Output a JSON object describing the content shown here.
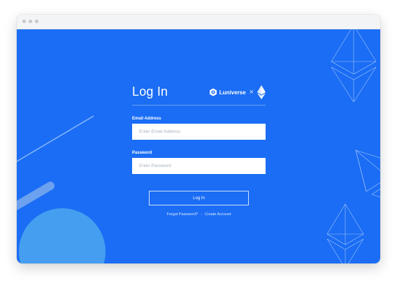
{
  "colors": {
    "background": "#1a6df4",
    "text": "#ffffff",
    "titlebar": "#f3f4f6"
  },
  "login": {
    "title": "Log In",
    "brand": {
      "name": "Luniverse",
      "separator": "×",
      "logo_icon": "luniverse-logo-icon",
      "partner_icon": "ethereum-icon"
    },
    "email": {
      "label": "Email Address",
      "placeholder": "Enter Email Address"
    },
    "password": {
      "label": "Password",
      "placeholder": "Enter Password"
    },
    "submit_label": "Log In",
    "forgot_label": "Forgot Password?",
    "link_separator": "-",
    "create_label": "Create Account"
  }
}
